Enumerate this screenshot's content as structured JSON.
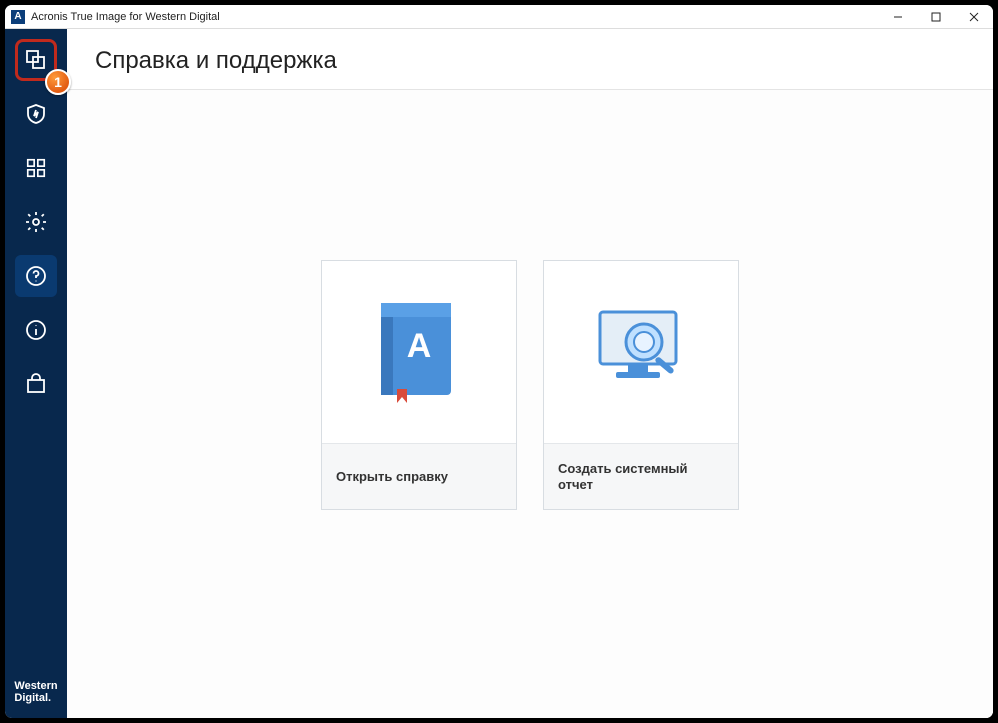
{
  "window": {
    "title": "Acronis True Image for Western Digital"
  },
  "header": {
    "title": "Справка и поддержка"
  },
  "callout": {
    "number": "1"
  },
  "cards": {
    "help": {
      "label": "Открыть справку"
    },
    "report": {
      "label": "Создать системный отчет"
    }
  },
  "brand": {
    "line1": "Western",
    "line2": "Digital."
  }
}
